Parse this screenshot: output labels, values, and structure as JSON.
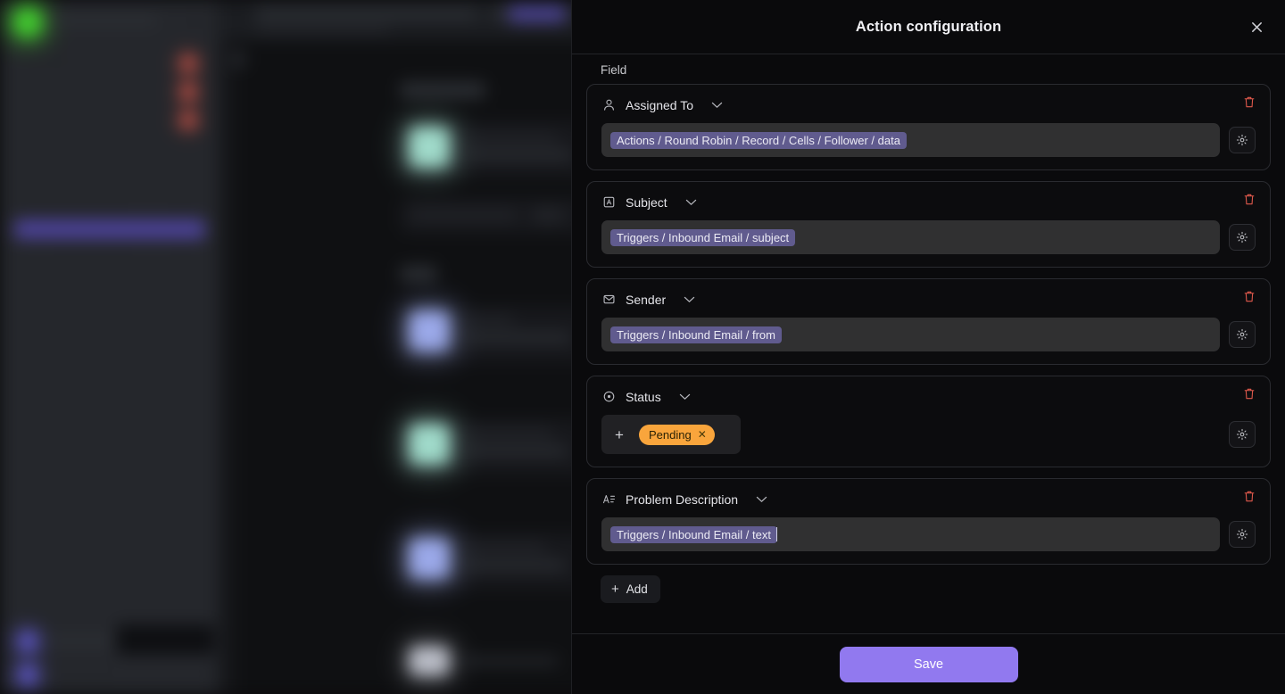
{
  "panel": {
    "title": "Action configuration",
    "close_icon": "close-icon",
    "section_label": "Field",
    "add_label": "Add",
    "save_label": "Save",
    "accent_color": "#9179ef",
    "token_color": "#605b8e",
    "badge_color": "#f9a53c",
    "delete_color": "#e0594c"
  },
  "fields": [
    {
      "name": "Assigned To",
      "icon": "person-icon",
      "value_token": "Actions / Round Robin / Record / Cells / Follower / data",
      "has_caret": false,
      "type": "token-input",
      "settings_icon": "gear-icon",
      "delete_icon": "trash-icon",
      "chevron_icon": "chevron-down-icon"
    },
    {
      "name": "Subject",
      "icon": "text-box-icon",
      "value_token": "Triggers / Inbound Email / subject",
      "has_caret": false,
      "type": "token-input",
      "settings_icon": "gear-icon",
      "delete_icon": "trash-icon",
      "chevron_icon": "chevron-down-icon"
    },
    {
      "name": "Sender",
      "icon": "envelope-icon",
      "value_token": "Triggers / Inbound Email / from",
      "has_caret": false,
      "type": "token-input",
      "settings_icon": "gear-icon",
      "delete_icon": "trash-icon",
      "chevron_icon": "chevron-down-icon"
    },
    {
      "name": "Status",
      "icon": "status-circle-icon",
      "badge": "Pending",
      "badge_remove_icon": "x-icon",
      "add_value_icon": "plus-icon",
      "type": "select-badge",
      "settings_icon": "gear-icon",
      "delete_icon": "trash-icon",
      "chevron_icon": "chevron-down-icon"
    },
    {
      "name": "Problem Description",
      "icon": "long-text-icon",
      "value_token": "Triggers / Inbound Email / text",
      "has_caret": true,
      "type": "token-input",
      "settings_icon": "gear-icon",
      "delete_icon": "trash-icon",
      "chevron_icon": "chevron-down-icon"
    }
  ]
}
